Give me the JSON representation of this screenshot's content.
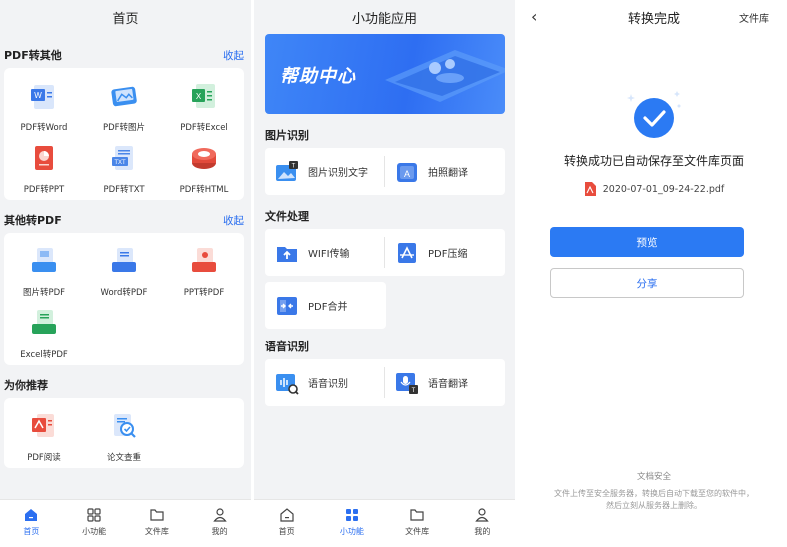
{
  "home": {
    "title": "首页",
    "section1": {
      "title": "PDF转其他",
      "action": "收起",
      "items": [
        {
          "label": "PDF转Word",
          "icon": "word-doc-icon",
          "color": "#3a78e8"
        },
        {
          "label": "PDF转图片",
          "icon": "image-doc-icon",
          "color": "#3a8ff0"
        },
        {
          "label": "PDF转Excel",
          "icon": "excel-doc-icon",
          "color": "#27a35a"
        },
        {
          "label": "PDF转PPT",
          "icon": "ppt-doc-icon",
          "color": "#e84c3d"
        },
        {
          "label": "PDF转TXT",
          "icon": "txt-doc-icon",
          "color": "#4a86e8"
        },
        {
          "label": "PDF转HTML",
          "icon": "html-doc-icon",
          "color": "#e24a3b"
        }
      ]
    },
    "section2": {
      "title": "其他转PDF",
      "action": "收起",
      "items": [
        {
          "label": "图片转PDF",
          "icon": "image-to-pdf-icon",
          "color": "#3a8ff0"
        },
        {
          "label": "Word转PDF",
          "icon": "word-to-pdf-icon",
          "color": "#3a78e8"
        },
        {
          "label": "PPT转PDF",
          "icon": "ppt-to-pdf-icon",
          "color": "#e84c3d"
        },
        {
          "label": "Excel转PDF",
          "icon": "excel-to-pdf-icon",
          "color": "#27a35a"
        }
      ]
    },
    "section3": {
      "title": "为你推荐",
      "items": [
        {
          "label": "PDF阅读",
          "icon": "pdf-reader-icon",
          "color": "#e84c3d"
        },
        {
          "label": "论文查重",
          "icon": "paper-check-icon",
          "color": "#3a8ff0"
        }
      ]
    }
  },
  "tools": {
    "title": "小功能应用",
    "banner": "帮助中心",
    "groups": [
      {
        "title": "图片识别",
        "items": [
          {
            "label": "图片识别文字",
            "icon": "image-ocr-icon"
          },
          {
            "label": "拍照翻译",
            "icon": "photo-translate-icon"
          }
        ]
      },
      {
        "title": "文件处理",
        "items": [
          {
            "label": "WIFI传输",
            "icon": "wifi-transfer-icon"
          },
          {
            "label": "PDF压缩",
            "icon": "pdf-compress-icon"
          },
          {
            "label": "PDF合并",
            "icon": "pdf-merge-icon"
          }
        ]
      },
      {
        "title": "语音识别",
        "items": [
          {
            "label": "语音识别",
            "icon": "voice-recognition-icon"
          },
          {
            "label": "语音翻译",
            "icon": "voice-translate-icon"
          }
        ]
      }
    ]
  },
  "result": {
    "title": "转换完成",
    "library_link": "文件库",
    "message": "转换成功已自动保存至文件库页面",
    "filename": "2020-07-01_09-24-22.pdf",
    "preview_label": "预览",
    "share_label": "分享",
    "security_title": "文档安全",
    "security_desc": "文件上传至安全服务器，转换后自动下载至您的软件中，然后立刻从服务器上删除。"
  },
  "tabbar": {
    "tabs": [
      {
        "label": "首页",
        "icon": "home-icon"
      },
      {
        "label": "小功能",
        "icon": "grid-icon"
      },
      {
        "label": "文件库",
        "icon": "folder-icon"
      },
      {
        "label": "我的",
        "icon": "person-icon"
      }
    ],
    "active_color": "#2b6ff0"
  }
}
